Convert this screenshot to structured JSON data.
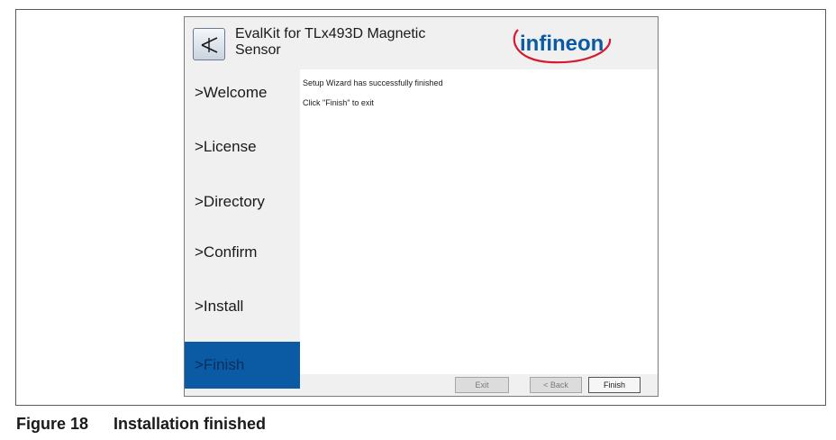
{
  "window": {
    "title": "EvalKit for TLx493D Magnetic Sensor",
    "logo_text": "infineon"
  },
  "sidebar": {
    "items": [
      {
        "label": ">Welcome",
        "active": false
      },
      {
        "label": ">License",
        "active": false
      },
      {
        "label": ">Directory",
        "active": false
      },
      {
        "label": ">Confirm",
        "active": false
      },
      {
        "label": ">Install",
        "active": false
      },
      {
        "label": ">Finish",
        "active": true
      }
    ]
  },
  "content": {
    "line1": "Setup Wizard has successfully finished",
    "line2": "Click \"Finish\" to exit"
  },
  "footer": {
    "exit_label": "Exit",
    "back_label": "< Back",
    "finish_label": "Finish"
  },
  "caption": {
    "label": "Figure 18",
    "text": "Installation finished"
  },
  "colors": {
    "accent": "#0a5aa4",
    "logo_text": "#0a5aa4",
    "logo_arc": "#d7192f"
  },
  "icons": {
    "app_icon": "antenna-arrow-icon"
  }
}
